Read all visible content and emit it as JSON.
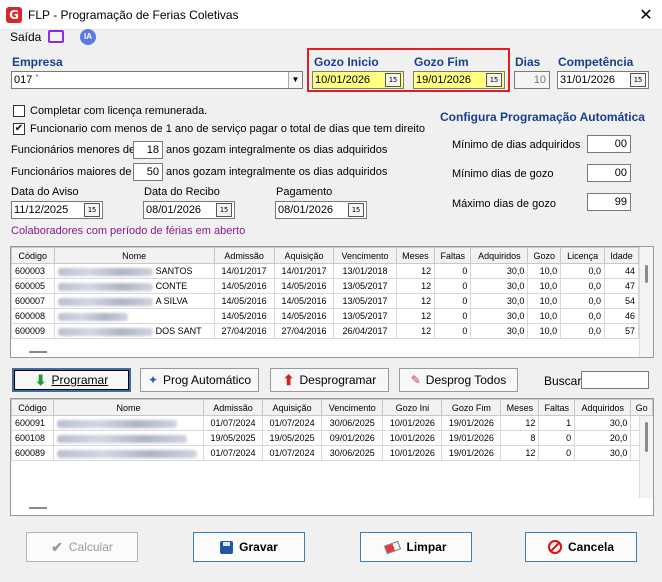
{
  "window": {
    "title": "FLP - Programação de Ferias Coletivas",
    "close": "✕",
    "app_icon": "G"
  },
  "menu": {
    "saida": "Saída",
    "ia": "IA"
  },
  "empresa": {
    "label": "Empresa",
    "value": "017 `"
  },
  "gozo_inicio": {
    "label": "Gozo Inicio",
    "value": "10/01/2026"
  },
  "gozo_fim": {
    "label": "Gozo Fim",
    "value": "19/01/2026"
  },
  "dias": {
    "label": "Dias",
    "value": "10"
  },
  "competencia": {
    "label": "Competência",
    "value": "31/01/2026"
  },
  "options": {
    "completar_licenca": {
      "label": "Completar com licença remunerada.",
      "checked": false
    },
    "menos_1_ano": {
      "label": "Funcionario com menos de 1 ano de serviço pagar o total de dias que tem direito",
      "checked": true
    }
  },
  "func_menores": {
    "prefix": "Funcionários menores de",
    "value": "18",
    "suffix": "anos gozam integralmente os dias adquiridos"
  },
  "func_maiores": {
    "prefix": "Funcionários  maiores de",
    "value": "50",
    "suffix": "anos gozam integralmente os dias adquiridos"
  },
  "auto_config": {
    "title": "Configura Programação Automática",
    "minimo_adquiridos": {
      "label": "Mínimo de dias adquiridos",
      "value": "00"
    },
    "minimo_gozo": {
      "label": "Mínimo dias de gozo",
      "value": "00"
    },
    "maximo_gozo": {
      "label": "Máximo dias de gozo",
      "value": "99"
    }
  },
  "data_aviso": {
    "label": "Data do Aviso",
    "value": "11/12/2025"
  },
  "data_recibo": {
    "label": "Data do Recibo",
    "value": "08/01/2026"
  },
  "pagamento": {
    "label": "Pagamento",
    "value": "08/01/2026"
  },
  "open_period_label": "Colaboradores com período de férias em aberto",
  "grid1": {
    "columns": [
      "Código",
      "Nome",
      "Admissão",
      "Aquisição",
      "Vencimento",
      "Meses",
      "Faltas",
      "Adquiridos",
      "Gozo",
      "Licença",
      "Idade"
    ],
    "rows": [
      {
        "codigo": "600003",
        "nome": "SANTOS",
        "admissao": "14/01/2017",
        "aquisicao": "14/01/2017",
        "vencimento": "13/01/2018",
        "meses": "12",
        "faltas": "0",
        "adquiridos": "30,0",
        "gozo": "10,0",
        "licenca": "0,0",
        "idade": "44"
      },
      {
        "codigo": "600005",
        "nome": "CONTE",
        "admissao": "14/05/2016",
        "aquisicao": "14/05/2016",
        "vencimento": "13/05/2017",
        "meses": "12",
        "faltas": "0",
        "adquiridos": "30,0",
        "gozo": "10,0",
        "licenca": "0,0",
        "idade": "47"
      },
      {
        "codigo": "600007",
        "nome": "A SILVA",
        "admissao": "14/05/2016",
        "aquisicao": "14/05/2016",
        "vencimento": "13/05/2017",
        "meses": "12",
        "faltas": "0",
        "adquiridos": "30,0",
        "gozo": "10,0",
        "licenca": "0,0",
        "idade": "54"
      },
      {
        "codigo": "600008",
        "nome": "",
        "admissao": "14/05/2016",
        "aquisicao": "14/05/2016",
        "vencimento": "13/05/2017",
        "meses": "12",
        "faltas": "0",
        "adquiridos": "30,0",
        "gozo": "10,0",
        "licenca": "0,0",
        "idade": "46"
      },
      {
        "codigo": "600009",
        "nome": "DOS SANT",
        "admissao": "27/04/2016",
        "aquisicao": "27/04/2016",
        "vencimento": "26/04/2017",
        "meses": "12",
        "faltas": "0",
        "adquiridos": "30,0",
        "gozo": "10,0",
        "licenca": "0,0",
        "idade": "57"
      }
    ]
  },
  "actions": {
    "programar": "Programar",
    "prog_automatico": "Prog Automático",
    "desprogramar": "Desprogramar",
    "desprog_todos": "Desprog Todos",
    "buscar": "Buscar"
  },
  "grid2": {
    "columns": [
      "Código",
      "Nome",
      "Admissão",
      "Aquisição",
      "Vencimento",
      "Gozo Ini",
      "Gozo Fim",
      "Meses",
      "Faltas",
      "Adquiridos",
      "Go"
    ],
    "rows": [
      {
        "codigo": "600091",
        "admissao": "01/07/2024",
        "aquisicao": "01/07/2024",
        "vencimento": "30/06/2025",
        "gozo_ini": "10/01/2026",
        "gozo_fim": "19/01/2026",
        "meses": "12",
        "faltas": "1",
        "adquiridos": "30,0"
      },
      {
        "codigo": "600108",
        "admissao": "19/05/2025",
        "aquisicao": "19/05/2025",
        "vencimento": "09/01/2026",
        "gozo_ini": "10/01/2026",
        "gozo_fim": "19/01/2026",
        "meses": "8",
        "faltas": "0",
        "adquiridos": "20,0"
      },
      {
        "codigo": "600089",
        "admissao": "01/07/2024",
        "aquisicao": "01/07/2024",
        "vencimento": "30/06/2025",
        "gozo_ini": "10/01/2026",
        "gozo_fim": "19/01/2026",
        "meses": "12",
        "faltas": "0",
        "adquiridos": "30,0"
      }
    ]
  },
  "footer": {
    "calcular": "Calcular",
    "gravar": "Gravar",
    "limpar": "Limpar",
    "cancela": "Cancela"
  }
}
